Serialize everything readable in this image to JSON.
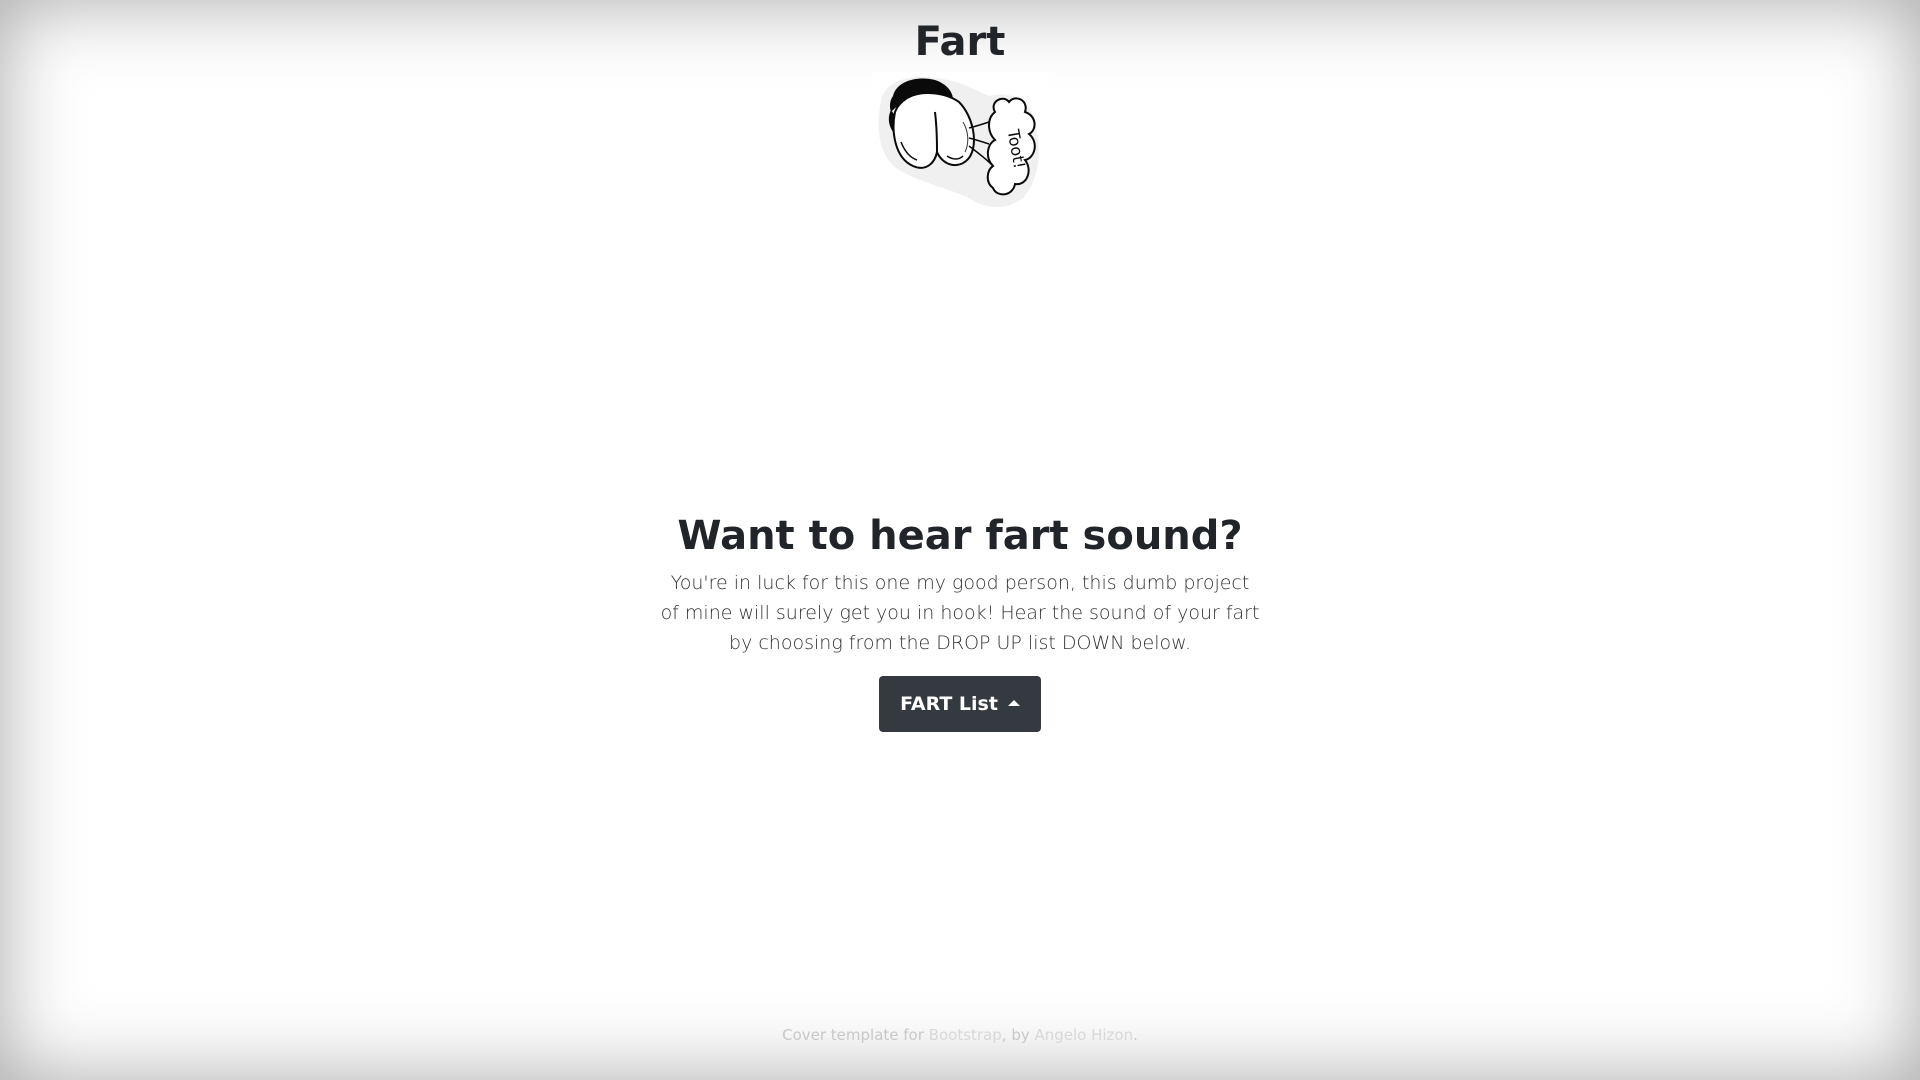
{
  "header": {
    "brand": "Fart"
  },
  "logo": {
    "icon": "fart-cartoon-icon"
  },
  "main": {
    "headline": "Want to hear fart sound?",
    "lead": "You're in luck for this one my good person, this dumb project of mine will surely get you in hook! Hear the sound of your fart by choosing from the DROP UP list DOWN below.",
    "button_label": "FART List"
  },
  "footer": {
    "prefix": "Cover template for ",
    "link_bootstrap": "Bootstrap",
    "middle": ", by ",
    "link_author": "Angelo Hizon",
    "suffix": "."
  },
  "colors": {
    "button_bg": "#343a40",
    "text": "#212529",
    "footer_text": "#c8c8c8"
  }
}
